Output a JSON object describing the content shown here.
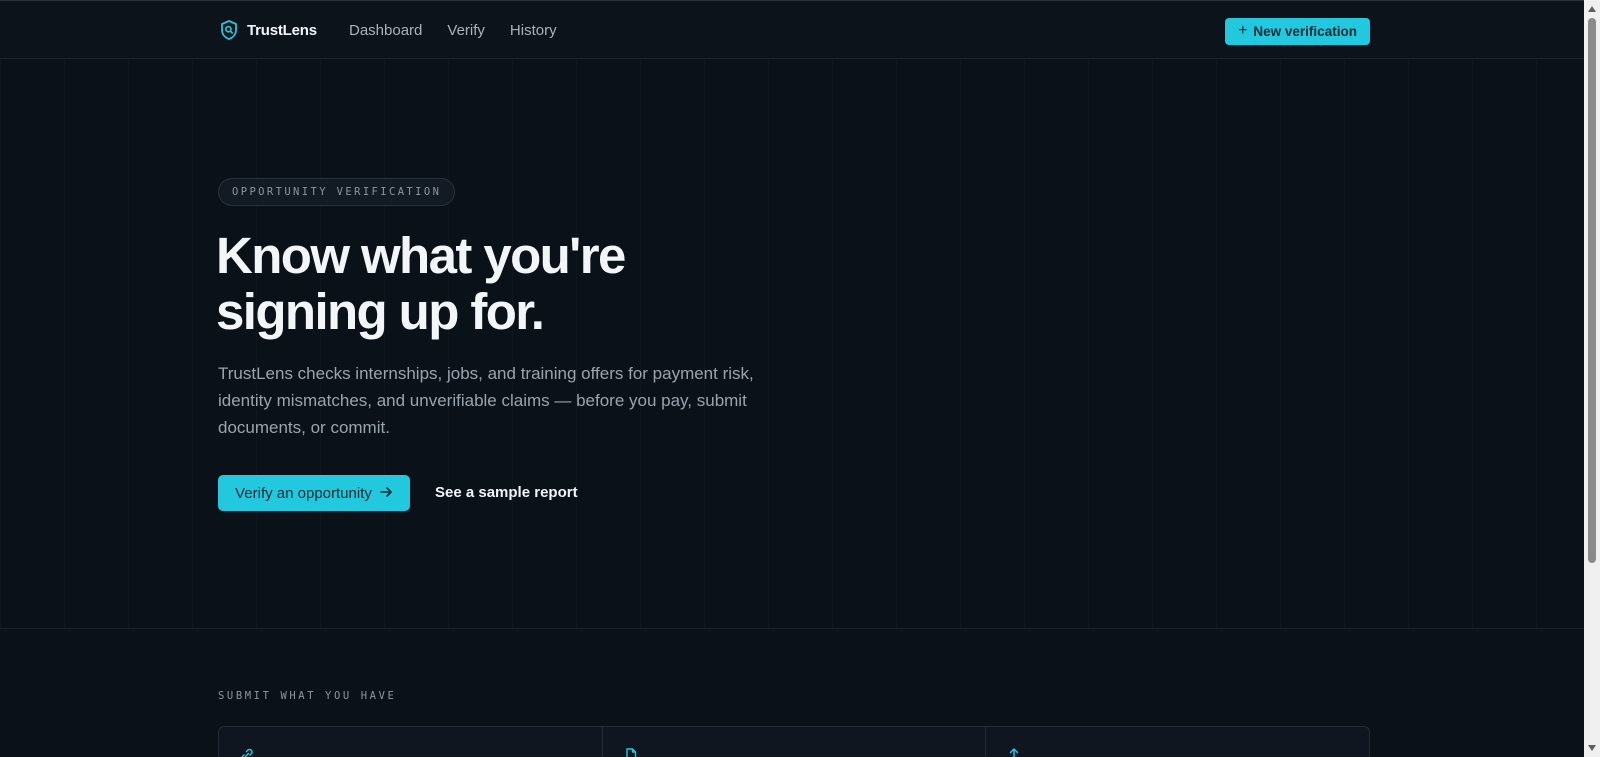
{
  "brand": {
    "name": "TrustLens",
    "icon": "shield-search-icon"
  },
  "nav": {
    "links": [
      "Dashboard",
      "Verify",
      "History"
    ],
    "new_button_label": "New verification",
    "new_button_icon": "plus-icon"
  },
  "hero": {
    "eyebrow": "OPPORTUNITY VERIFICATION",
    "headline_line1": "Know what you're",
    "headline_line2": "signing up for.",
    "subtext": "TrustLens checks internships, jobs, and training offers for payment risk, identity mismatches, and unverifiable claims — before you pay, submit documents, or commit.",
    "cta_primary": "Verify an opportunity",
    "cta_secondary": "See a sample report"
  },
  "submit": {
    "label": "SUBMIT WHAT YOU HAVE",
    "card_icons": [
      "link-icon",
      "document-icon",
      "upload-icon"
    ]
  },
  "colors": {
    "accent": "#22c9de",
    "background": "#0b1119",
    "text_primary": "#f3f6f9",
    "text_muted": "#9aa4ae"
  }
}
